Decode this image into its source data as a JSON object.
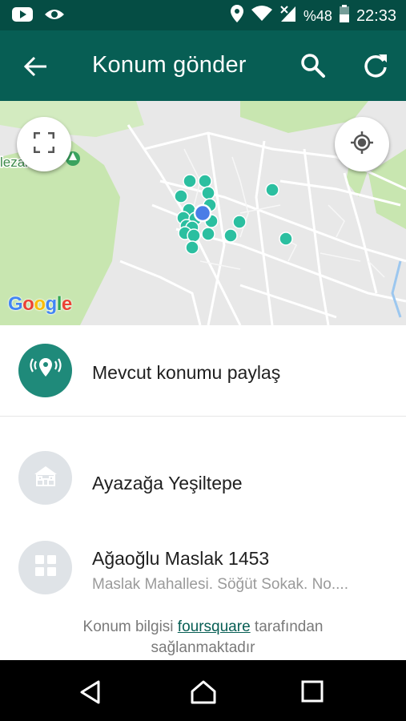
{
  "status_bar": {
    "battery_text": "%48",
    "time": "22:33",
    "left_icons": [
      "youtube-icon",
      "eye-app-icon"
    ],
    "right_icons": [
      "location-pin-icon",
      "wifi-icon",
      "signal-icon",
      "battery-icon"
    ]
  },
  "app_bar": {
    "title": "Konum gönder",
    "background": "#075e54"
  },
  "map": {
    "brand": "Google",
    "visible_label": "lezarlığı",
    "marker_color": "#2bbfa0",
    "current_location_color": "#4a7de6"
  },
  "list": {
    "share_current": {
      "label": "Mevcut konumu paylaş",
      "icon": "broadcast-location-icon",
      "color": "#1f8a7a"
    },
    "places": [
      {
        "name": "Ayazağa Yeşiltepe",
        "address": "",
        "icon": "house-icon"
      },
      {
        "name": "Ağaoğlu Maslak 1453",
        "address": "Maslak Mahallesi. Söğüt Sokak. No....",
        "icon": "building-icon"
      }
    ],
    "attribution": {
      "prefix": "Konum bilgisi ",
      "link": "foursquare",
      "suffix": " tarafından",
      "line2": "sağlanmaktadır"
    }
  }
}
